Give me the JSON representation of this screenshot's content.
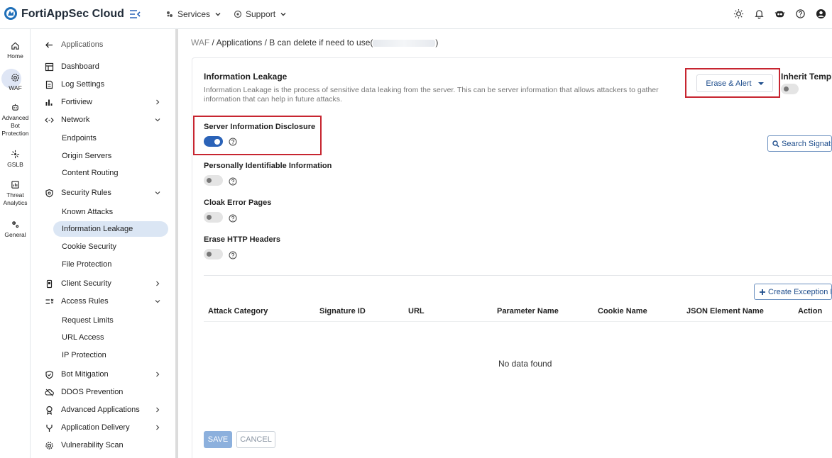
{
  "app": {
    "brand": "FortiAppSec Cloud"
  },
  "topnav": {
    "services": "Services",
    "support": "Support"
  },
  "rail": {
    "items": [
      {
        "label": "Home"
      },
      {
        "label": "WAF"
      },
      {
        "label": "Advanced Bot Protection",
        "line1": "Advanced",
        "line2": "Bot",
        "line3": "Protection"
      },
      {
        "label": "GSLB"
      },
      {
        "label": "Threat Analytics",
        "line1": "Threat",
        "line2": "Analytics"
      },
      {
        "label": "General"
      }
    ],
    "more": "•••"
  },
  "sidemenu": {
    "back": "Applications",
    "items": {
      "dashboard": "Dashboard",
      "log_settings": "Log Settings",
      "fortiview": "Fortiview",
      "network": "Network",
      "endpoints": "Endpoints",
      "origin_servers": "Origin Servers",
      "content_routing": "Content Routing",
      "security_rules": "Security Rules",
      "known_attacks": "Known Attacks",
      "information_leakage": "Information Leakage",
      "cookie_security": "Cookie Security",
      "file_protection": "File Protection",
      "client_security": "Client Security",
      "access_rules": "Access Rules",
      "request_limits": "Request Limits",
      "url_access": "URL Access",
      "ip_protection": "IP Protection",
      "bot_mitigation": "Bot Mitigation",
      "ddos_prevention": "DDOS Prevention",
      "advanced_applications": "Advanced Applications",
      "application_delivery": "Application Delivery",
      "vulnerability_scan": "Vulnerability Scan"
    }
  },
  "breadcrumb": {
    "waf": "WAF",
    "sep": " / ",
    "applications": "Applications",
    "app_prefix": "B can delete if need to use(",
    "app_suffix": ")"
  },
  "section": {
    "title": "Information Leakage",
    "description": "Information Leakage is the process of sensitive data leaking from the server. This can be server information that allows attackers to gather information that can help in future attacks.",
    "action_dropdown": "Erase & Alert",
    "inherit_label": "Inherit Templa",
    "inherit_enabled": false
  },
  "options": [
    {
      "label": "Server Information Disclosure",
      "enabled": true
    },
    {
      "label": "Personally Identifiable Information",
      "enabled": false
    },
    {
      "label": "Cloak Error Pages",
      "enabled": false
    },
    {
      "label": "Erase HTTP Headers",
      "enabled": false
    }
  ],
  "buttons": {
    "search_signatures": "Search Signatu",
    "create_exception": "Create Exception R",
    "save": "SAVE",
    "cancel": "CANCEL"
  },
  "table": {
    "columns": [
      "Attack Category",
      "Signature ID",
      "URL",
      "Parameter Name",
      "Cookie Name",
      "JSON Element Name",
      "Action"
    ],
    "empty": "No data found"
  },
  "colors": {
    "accent": "#2b63b8",
    "highlight": "#c72530",
    "active_menu": "#dbe6f4"
  }
}
